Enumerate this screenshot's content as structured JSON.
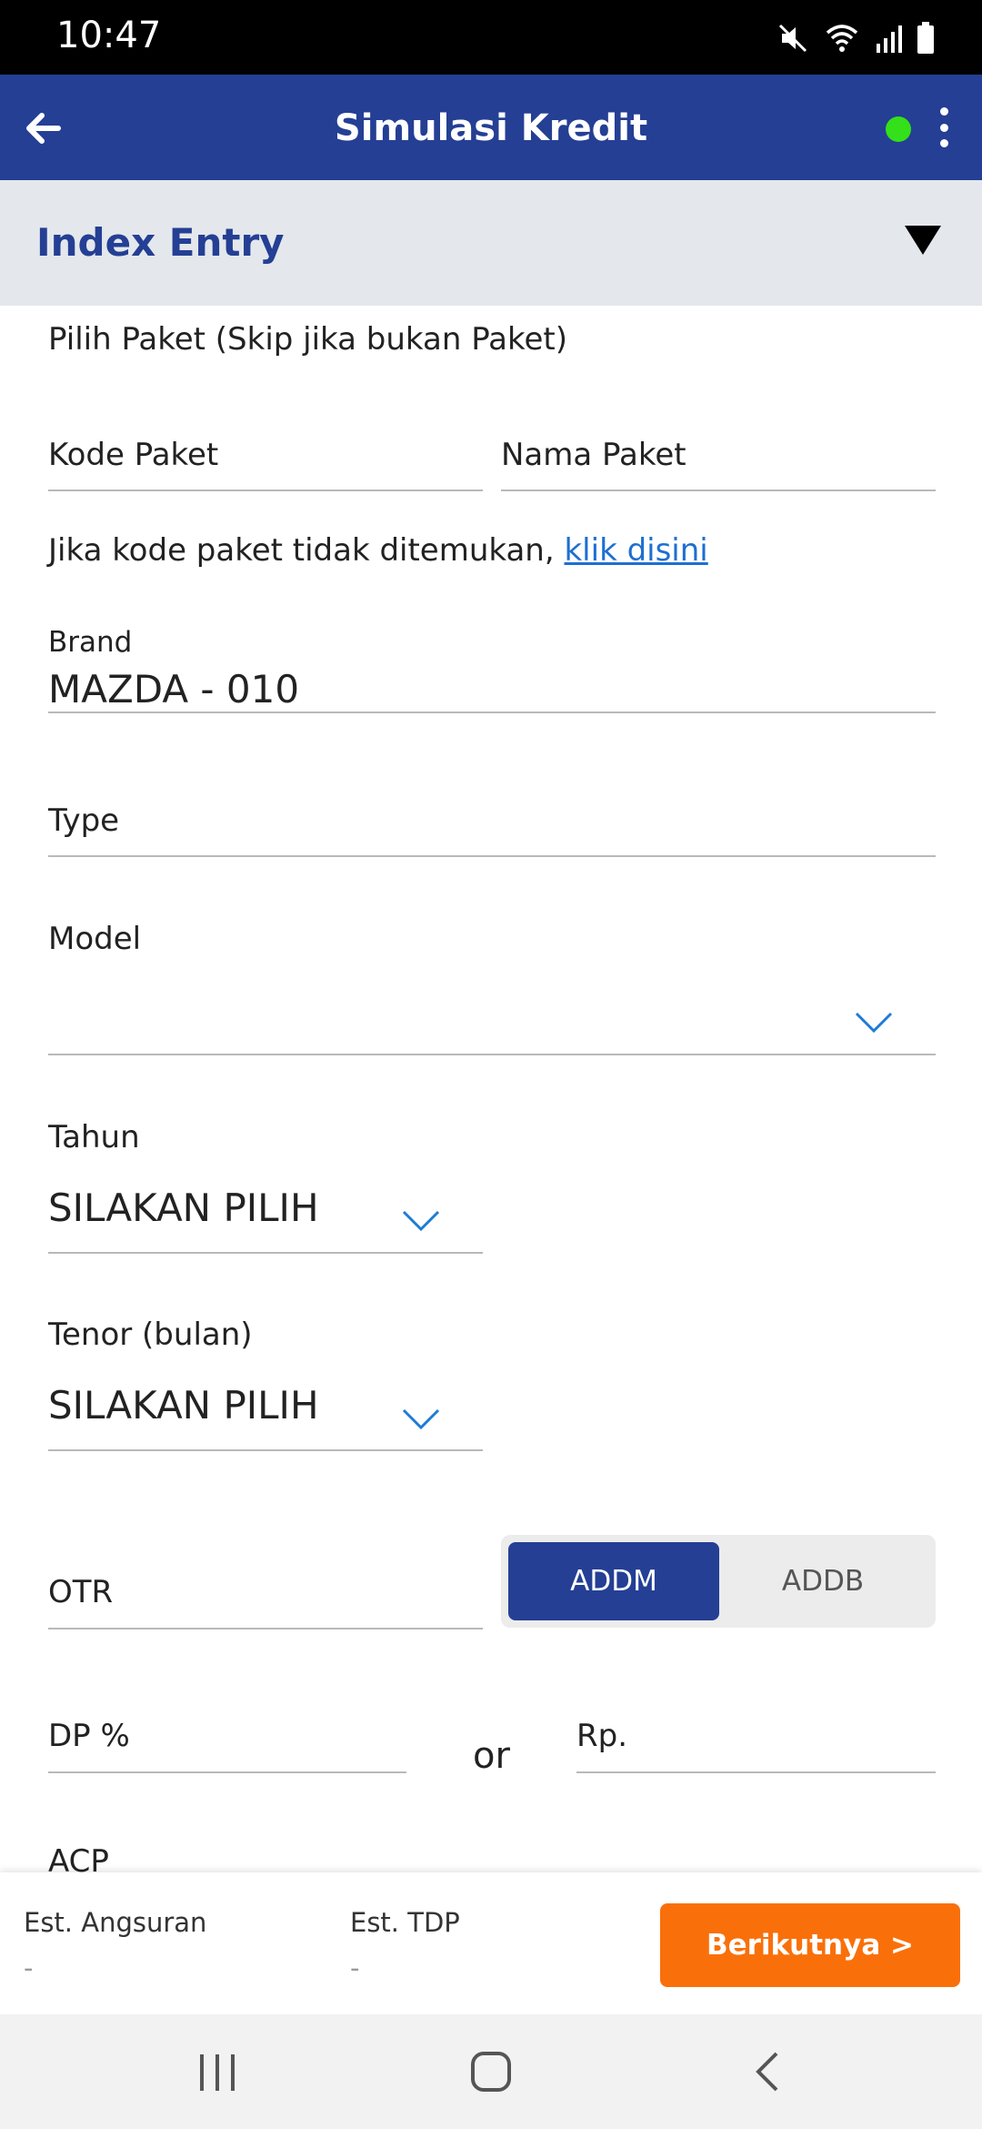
{
  "status_bar": {
    "time": "10:47"
  },
  "app_bar": {
    "title": "Simulasi Kredit"
  },
  "section": {
    "title": "Index Entry"
  },
  "form": {
    "package_prompt": "Pilih Paket (Skip jika bukan Paket)",
    "kode_paket_label": "Kode Paket",
    "nama_paket_label": "Nama Paket",
    "not_found_text": "Jika kode paket tidak ditemukan, ",
    "not_found_link": "klik disini",
    "brand_label": "Brand",
    "brand_value": "MAZDA - 010",
    "type_label": "Type",
    "model_label": "Model",
    "tahun_label": "Tahun",
    "tahun_value": "SILAKAN PILIH",
    "tenor_label": "Tenor (bulan)",
    "tenor_value": "SILAKAN PILIH",
    "otr_label": "OTR",
    "toggle": {
      "option_1": "ADDM",
      "option_2": "ADDB",
      "selected": "ADDM"
    },
    "dp_label": "DP %",
    "or_text": "or",
    "rp_label": "Rp.",
    "acp_label": "ACP"
  },
  "summary": {
    "angsuran_label": "Est. Angsuran",
    "angsuran_value": "-",
    "tdp_label": "Est. TDP",
    "tdp_value": "-",
    "next_button": "Berikutnya >"
  },
  "colors": {
    "primary": "#243f94",
    "accent_orange": "#f9700a",
    "online": "#33e01a",
    "link": "#1e6fd0",
    "chevron": "#1e7bd6"
  }
}
